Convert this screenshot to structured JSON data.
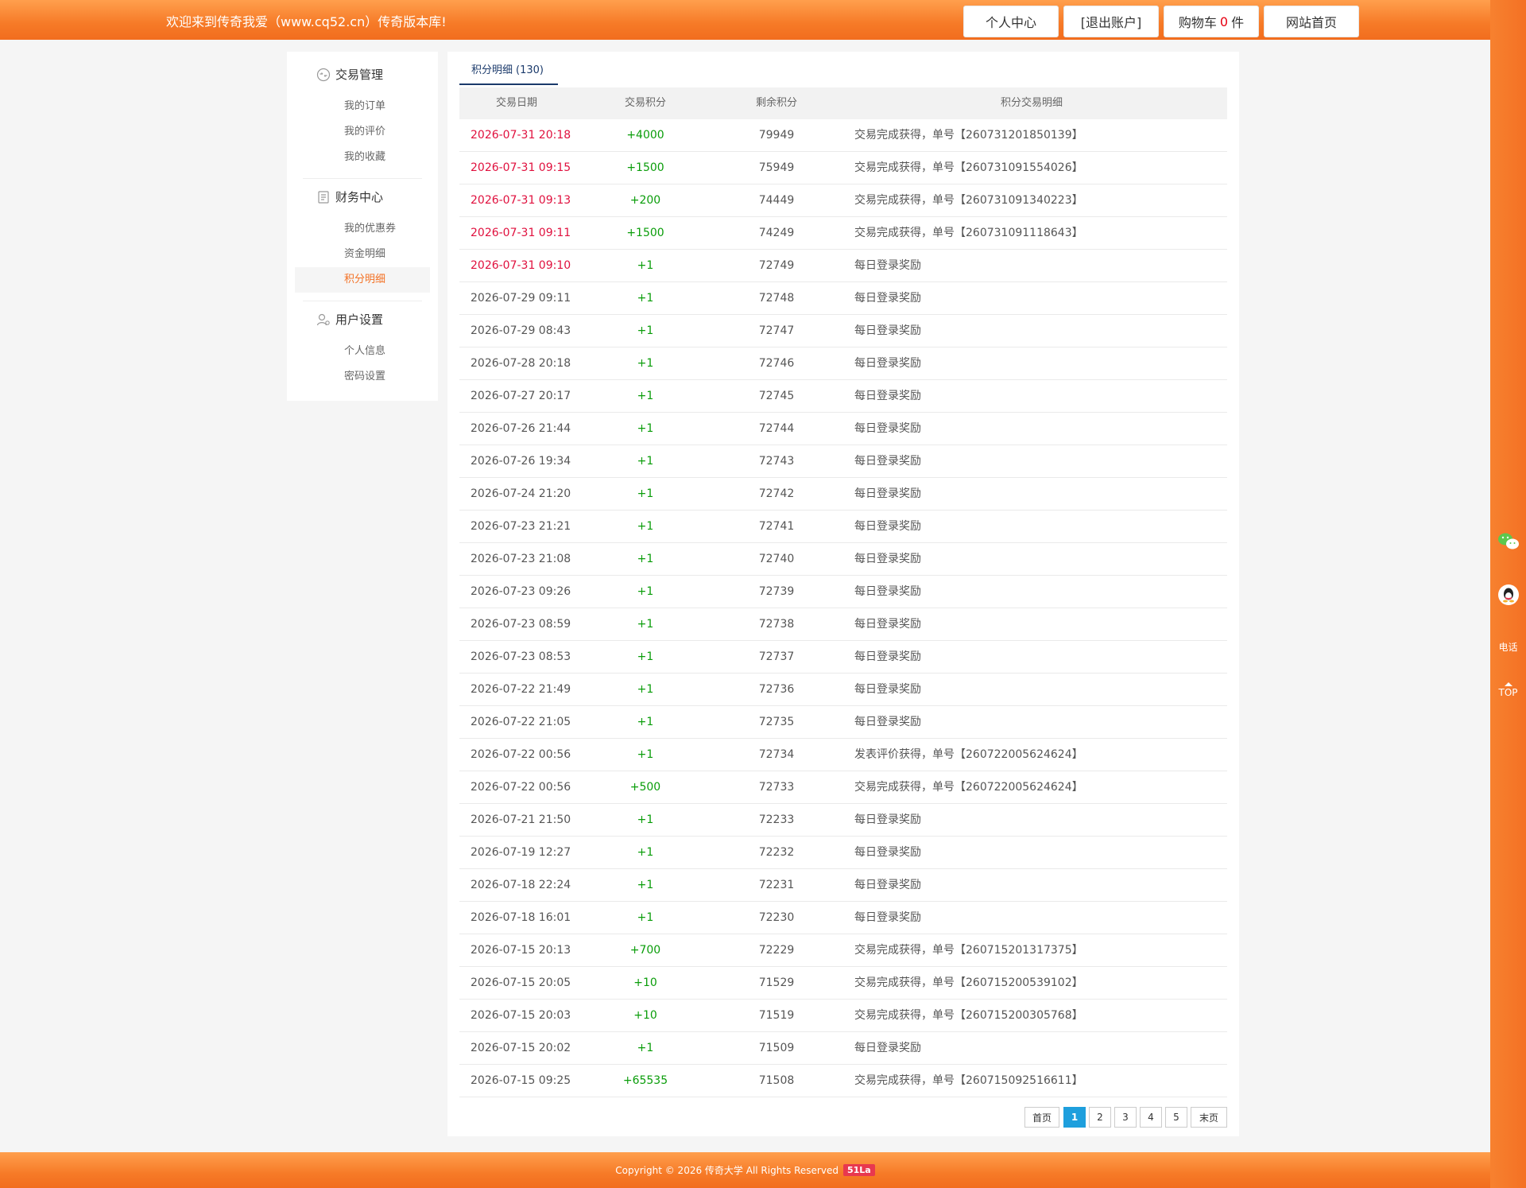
{
  "header": {
    "welcome": "欢迎来到传奇我爱（www.cq52.cn）传奇版本库!",
    "nav": {
      "personal_center": "个人中心",
      "logout": "[退出账户]",
      "cart_label": "购物车",
      "cart_count": "0",
      "cart_unit": "件",
      "home": "网站首页"
    }
  },
  "menu": {
    "groups": [
      {
        "title": "交易管理",
        "icon": "exchange-icon",
        "items": [
          "我的订单",
          "我的评价",
          "我的收藏"
        ]
      },
      {
        "title": "财务中心",
        "icon": "ledger-icon",
        "items": [
          "我的优惠券",
          "资金明细",
          "积分明细"
        ]
      },
      {
        "title": "用户设置",
        "icon": "user-gear-icon",
        "items": [
          "个人信息",
          "密码设置"
        ]
      }
    ],
    "active_item": "积分明细"
  },
  "tab": {
    "label": "积分明细",
    "count": "(130)"
  },
  "table": {
    "headers": [
      "交易日期",
      "交易积分",
      "剩余积分",
      "积分交易明细"
    ],
    "rows": [
      [
        "2026-07-31 20:18",
        "+4000",
        "79949",
        "交易完成获得，单号【260731201850139】"
      ],
      [
        "2026-07-31 09:15",
        "+1500",
        "75949",
        "交易完成获得，单号【260731091554026】"
      ],
      [
        "2026-07-31 09:13",
        "+200",
        "74449",
        "交易完成获得，单号【260731091340223】"
      ],
      [
        "2026-07-31 09:11",
        "+1500",
        "74249",
        "交易完成获得，单号【260731091118643】"
      ],
      [
        "2026-07-31 09:10",
        "+1",
        "72749",
        "每日登录奖励"
      ],
      [
        "2026-07-29 09:11",
        "+1",
        "72748",
        "每日登录奖励"
      ],
      [
        "2026-07-29 08:43",
        "+1",
        "72747",
        "每日登录奖励"
      ],
      [
        "2026-07-28 20:18",
        "+1",
        "72746",
        "每日登录奖励"
      ],
      [
        "2026-07-27 20:17",
        "+1",
        "72745",
        "每日登录奖励"
      ],
      [
        "2026-07-26 21:44",
        "+1",
        "72744",
        "每日登录奖励"
      ],
      [
        "2026-07-26 19:34",
        "+1",
        "72743",
        "每日登录奖励"
      ],
      [
        "2026-07-24 21:20",
        "+1",
        "72742",
        "每日登录奖励"
      ],
      [
        "2026-07-23 21:21",
        "+1",
        "72741",
        "每日登录奖励"
      ],
      [
        "2026-07-23 21:08",
        "+1",
        "72740",
        "每日登录奖励"
      ],
      [
        "2026-07-23 09:26",
        "+1",
        "72739",
        "每日登录奖励"
      ],
      [
        "2026-07-23 08:59",
        "+1",
        "72738",
        "每日登录奖励"
      ],
      [
        "2026-07-23 08:53",
        "+1",
        "72737",
        "每日登录奖励"
      ],
      [
        "2026-07-22 21:49",
        "+1",
        "72736",
        "每日登录奖励"
      ],
      [
        "2026-07-22 21:05",
        "+1",
        "72735",
        "每日登录奖励"
      ],
      [
        "2026-07-22 00:56",
        "+1",
        "72734",
        "发表评价获得，单号【260722005624624】"
      ],
      [
        "2026-07-22 00:56",
        "+500",
        "72733",
        "交易完成获得，单号【260722005624624】"
      ],
      [
        "2026-07-21 21:50",
        "+1",
        "72233",
        "每日登录奖励"
      ],
      [
        "2026-07-19 12:27",
        "+1",
        "72232",
        "每日登录奖励"
      ],
      [
        "2026-07-18 22:24",
        "+1",
        "72231",
        "每日登录奖励"
      ],
      [
        "2026-07-18 16:01",
        "+1",
        "72230",
        "每日登录奖励"
      ],
      [
        "2026-07-15 20:13",
        "+700",
        "72229",
        "交易完成获得，单号【260715201317375】"
      ],
      [
        "2026-07-15 20:05",
        "+10",
        "71529",
        "交易完成获得，单号【260715200539102】"
      ],
      [
        "2026-07-15 20:03",
        "+10",
        "71519",
        "交易完成获得，单号【260715200305768】"
      ],
      [
        "2026-07-15 20:02",
        "+1",
        "71509",
        "每日登录奖励"
      ],
      [
        "2026-07-15 09:25",
        "+65535",
        "71508",
        "交易完成获得，单号【260715092516611】"
      ]
    ],
    "highlight_rows": 5
  },
  "pagination": {
    "first": "首页",
    "pages": [
      "1",
      "2",
      "3",
      "4",
      "5"
    ],
    "current": "1",
    "last": "末页"
  },
  "float_bar": {
    "wechat_icon": "wechat-icon",
    "qq_icon": "qq-icon",
    "phone": "电话",
    "top": "TOP"
  },
  "footer": {
    "copyright": "Copyright © 2026 传奇大学 All Rights Reserved",
    "badge": "51La"
  },
  "colors": {
    "brand_orange": "#f47124",
    "date_red": "#e0103e",
    "points_green": "#0a9d0a",
    "tab_navy": "#1b3a6b",
    "pager_blue": "#1e9fdd"
  }
}
